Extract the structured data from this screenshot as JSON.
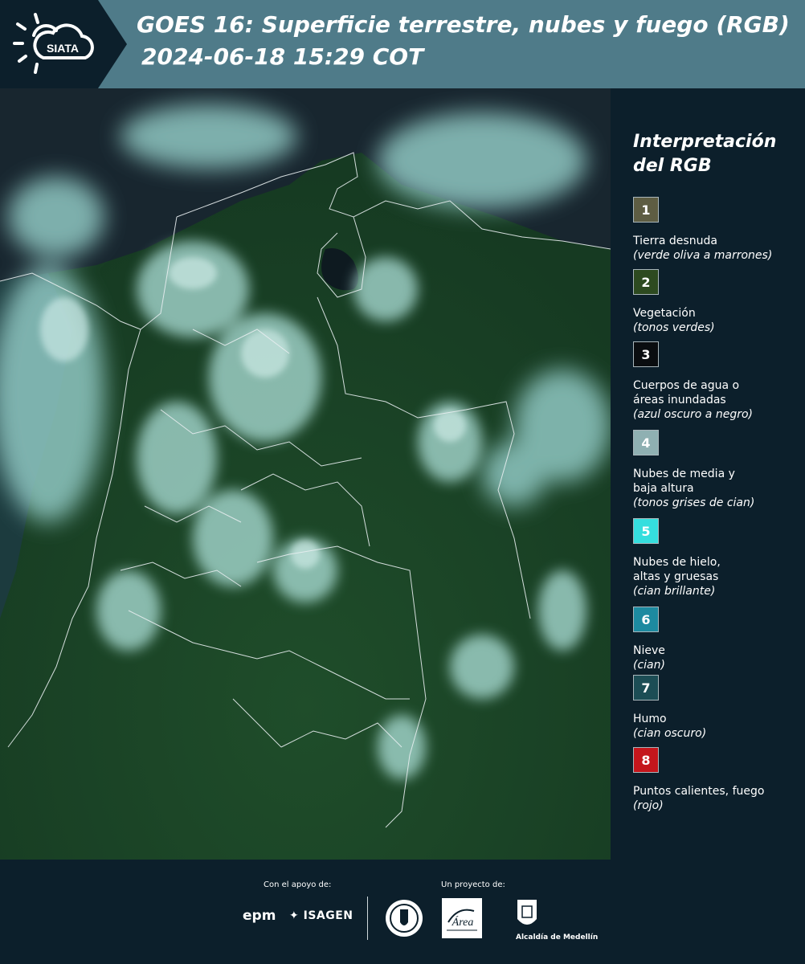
{
  "header": {
    "logo_text": "SIATA",
    "title": "GOES 16: Superficie terrestre, nubes y fuego (RGB)",
    "datetime": "2024-06-18 15:29 COT"
  },
  "legend": {
    "title": "Interpretación del RGB",
    "items": [
      {
        "number": "1",
        "label": "Tierra desnuda",
        "sub": "(verde oliva a marrones)",
        "color": "#5e5d43",
        "text_color": "#ffffff"
      },
      {
        "number": "2",
        "label": "Vegetación",
        "sub": "(tonos verdes)",
        "color": "#2d4a20",
        "text_color": "#ffffff"
      },
      {
        "number": "3",
        "label": "Cuerpos de agua o áreas inundadas",
        "sub": "(azul oscuro a negro)",
        "color": "#0a0d10",
        "text_color": "#ffffff"
      },
      {
        "number": "4",
        "label": "Nubes de media y baja altura",
        "sub": "(tonos grises de cian)",
        "color": "#8fb0b2",
        "text_color": "#ffffff"
      },
      {
        "number": "5",
        "label": "Nubes de hielo, altas y gruesas",
        "sub": "(cian brillante)",
        "color": "#35dede",
        "text_color": "#ffffff"
      },
      {
        "number": "6",
        "label": "Nieve",
        "sub": "(cian)",
        "color": "#1d8aa0",
        "text_color": "#ffffff"
      },
      {
        "number": "7",
        "label": "Humo",
        "sub": "(cian oscuro)",
        "color": "#1c4d55",
        "text_color": "#ffffff"
      },
      {
        "number": "8",
        "label": "Puntos calientes, fuego",
        "sub": "(rojo)",
        "color": "#c4161c",
        "text_color": "#ffffff"
      }
    ]
  },
  "footer": {
    "support_label": "Con el apoyo de:",
    "project_label": "Un proyecto de:",
    "epm": "epm",
    "isagen": "ISAGEN",
    "area_text": "Área",
    "alcaldia": "Alcaldía de Medellín"
  },
  "colors": {
    "header_bg": "#4f7b89",
    "panel_bg": "#0c1f2b",
    "vegetation": "#1e4226",
    "cloud": "#9fd3cf"
  }
}
